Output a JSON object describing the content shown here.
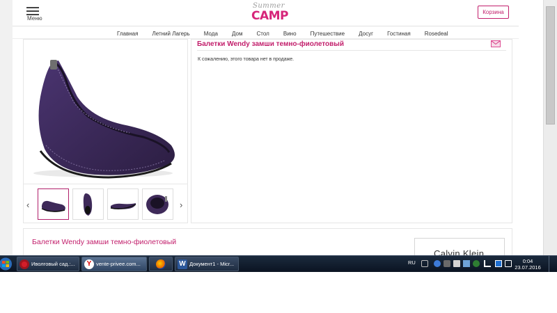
{
  "header": {
    "menu_label": "Меню",
    "logo_script": "Summer",
    "logo_main": "CAMP",
    "cart_label": "Корзина"
  },
  "nav": {
    "items": [
      "Главная",
      "Летний Лагерь",
      "Мода",
      "Дом",
      "Стол",
      "Вино",
      "Путешествие",
      "Досуг",
      "Гостиная",
      "Rosedeal"
    ]
  },
  "product": {
    "title": "Балетки Wendy замши темно-фиолетовый",
    "availability": "К сожалению, этого товара нет в продаже.",
    "thumbnails_count": 4,
    "active_thumbnail": 1
  },
  "details": {
    "title": "Балетки Wendy замши темно-фиолетовый",
    "brand": "Calvin Klein"
  },
  "taskbar": {
    "items": [
      {
        "label": "Иволговый сад.:...",
        "icon": "opera-icon"
      },
      {
        "label": "vente-privee.com...",
        "icon": "yandex-browser-icon"
      },
      {
        "label": "",
        "icon": "firefox-icon"
      },
      {
        "label": "Документ1 - Micr...",
        "icon": "word-icon"
      }
    ],
    "language": "RU",
    "time": "0:04",
    "date": "23.07.2016"
  },
  "colors": {
    "accent": "#c21e6b",
    "shoe": "#3e2a59",
    "taskbar": "#13203a"
  }
}
